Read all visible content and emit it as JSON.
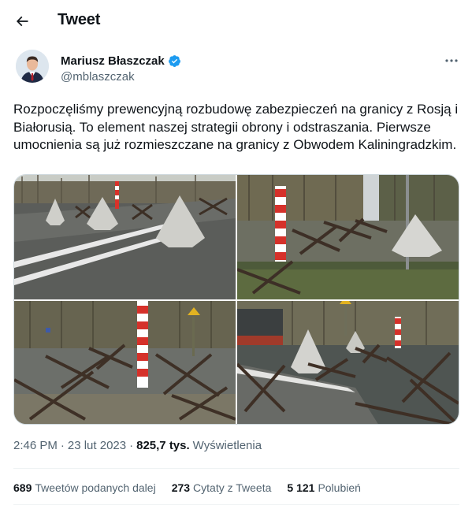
{
  "header": {
    "title": "Tweet",
    "back_icon": "arrow-left-icon"
  },
  "author": {
    "name": "Mariusz Błaszczak",
    "handle": "@mblaszczak",
    "verified": true,
    "verified_color": "#1d9bf0",
    "avatar_icon": "profile-photo"
  },
  "more_icon": "ellipsis-icon",
  "tweet": {
    "text": "Rozpoczęliśmy prewencyjną rozbudowę zabezpieczeń na granicy z Rosją i Białorusią. To element naszej strategii obrony i odstraszania. Pierwsze umocnienia są już rozmieszczane na granicy z Obwodem Kaliningradzkim."
  },
  "media": {
    "count": 4,
    "photos": [
      "concrete-barriers-road-photo",
      "border-post-hedgehogs-photo",
      "hedgehogs-forest-photo",
      "hedgehogs-truck-photo"
    ]
  },
  "meta": {
    "time": "2:46 PM",
    "separator1": "·",
    "date": "23 lut 2023",
    "separator2": "·",
    "views_count": "825,7 tys.",
    "views_label": "Wyświetlenia"
  },
  "stats": {
    "retweets_count": "689",
    "retweets_label": "Tweetów podanych dalej",
    "quotes_count": "273",
    "quotes_label": "Cytaty z Tweeta",
    "likes_count": "5 121",
    "likes_label": "Polubień"
  },
  "colors": {
    "text_primary": "#0f1419",
    "text_secondary": "#536471",
    "border": "#cfd9de",
    "accent": "#1d9bf0"
  }
}
